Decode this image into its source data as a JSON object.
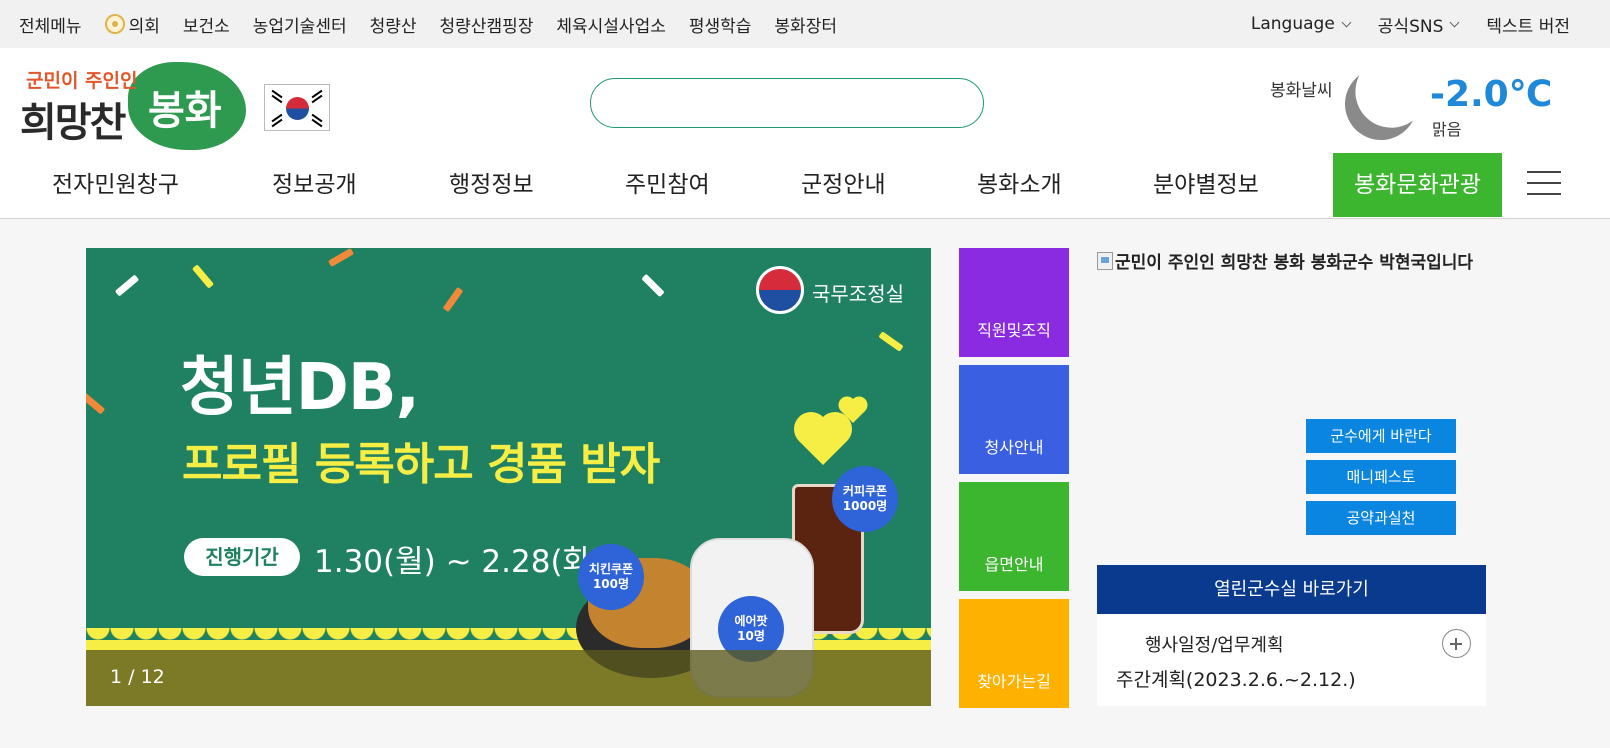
{
  "topbar": {
    "all_menu": "전체메뉴",
    "links": [
      "의회",
      "보건소",
      "농업기술센터",
      "청량산",
      "청량산캠핑장",
      "체육시설사업소",
      "평생학습",
      "봉화장터"
    ],
    "language": "Language",
    "sns": "공식SNS",
    "text_version": "텍스트 버전"
  },
  "header": {
    "logo_small": "군민이 주인인",
    "logo_big": "희망찬",
    "logo_brand": "봉화",
    "search_placeholder": "",
    "weather": {
      "label": "봉화날씨",
      "temperature": "-2.0℃",
      "condition": "맑음",
      "icon": "moon-icon"
    }
  },
  "gnb": {
    "items": [
      "전자민원창구",
      "정보공개",
      "행정정보",
      "주민참여",
      "군정안내",
      "봉화소개",
      "분야별정보"
    ],
    "highlight": "봉화문화관광",
    "highlight_color": "#3cb52f"
  },
  "banner": {
    "org": "국무조정실",
    "headline": "청년DB,",
    "subheadline": "프로필 등록하고 경품 받자",
    "period_label": "진행기간",
    "period": "1.30(월) ~ 2.28(화)",
    "badges": [
      {
        "text": "커피쿠폰\n1000명"
      },
      {
        "text": "치킨쿠폰\n100명"
      },
      {
        "text": "에어팟\n10명"
      }
    ],
    "counter": "1 / 12"
  },
  "quick_links": [
    {
      "label": "직원및조직",
      "color": "#8a2be2"
    },
    {
      "label": "청사안내",
      "color": "#3a5fe0"
    },
    {
      "label": "읍면안내",
      "color": "#3cb52f"
    },
    {
      "label": "찾아가는길",
      "color": "#ffb100"
    }
  ],
  "mayor": {
    "image_alt": "군민이 주인인 희망찬 봉화 봉화군수 박현국입니다",
    "buttons": [
      "군수에게 바란다",
      "매니페스토",
      "공약과실천"
    ]
  },
  "office": {
    "title": "열린군수실 바로가기",
    "schedule_label": "행사일정/업무계획",
    "weekly_plan": "주간계획(2023.2.6.~2.12.)"
  }
}
